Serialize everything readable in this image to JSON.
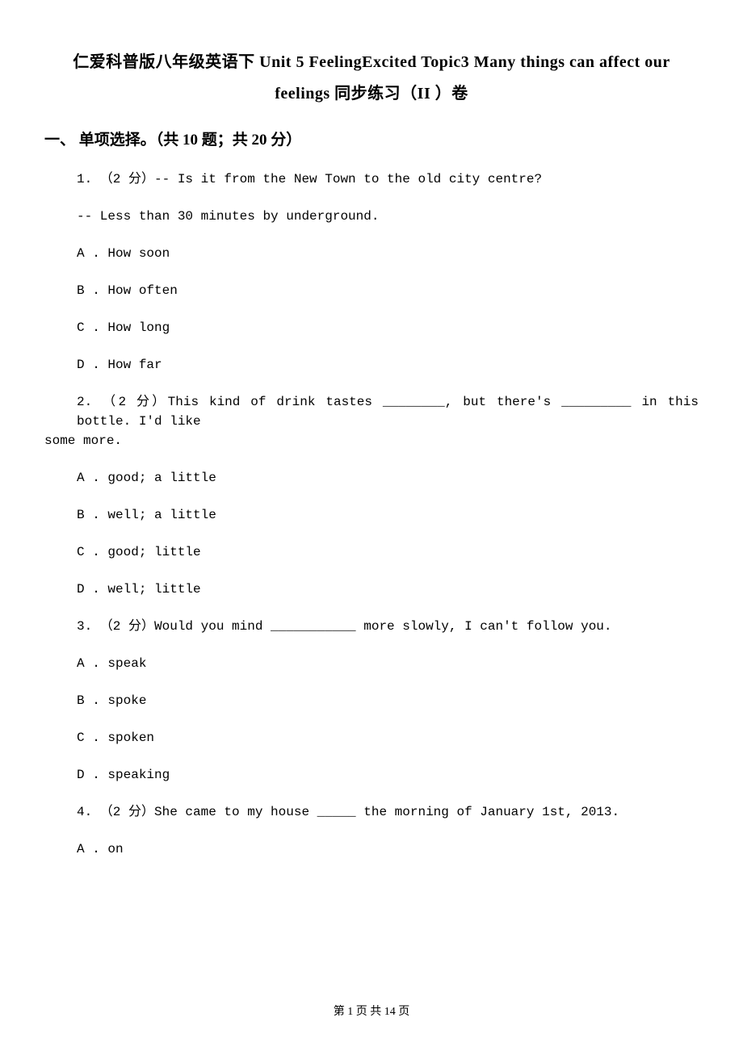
{
  "title_line1": "仁爱科普版八年级英语下 Unit 5 FeelingExcited Topic3 Many things can affect our",
  "title_line2": "feelings 同步练习（II ）卷",
  "section1_header": "一、 单项选择。（共 10 题；共 20 分）",
  "q1": {
    "stem": "1. （2 分）-- Is it from the New Town to the old city centre?",
    "cont": "-- Less than 30 minutes by underground.",
    "A": "A . How soon",
    "B": "B . How often",
    "C": "C . How long",
    "D": "D . How far"
  },
  "q2": {
    "line1": "2. （2 分）This kind of drink tastes ________, but there's _________ in this bottle. I'd like",
    "line2": "some more.",
    "A": "A . good; a little",
    "B": "B . well; a little",
    "C": "C . good; little",
    "D": "D . well; little"
  },
  "q3": {
    "stem": "3. （2 分）Would you mind ___________ more slowly, I can't follow you.",
    "A": "A . speak",
    "B": "B . spoke",
    "C": "C . spoken",
    "D": "D . speaking"
  },
  "q4": {
    "stem": "4. （2 分）She came to my house _____ the morning of January 1st, 2013.",
    "A": "A . on"
  },
  "footer": "第 1 页 共 14 页"
}
